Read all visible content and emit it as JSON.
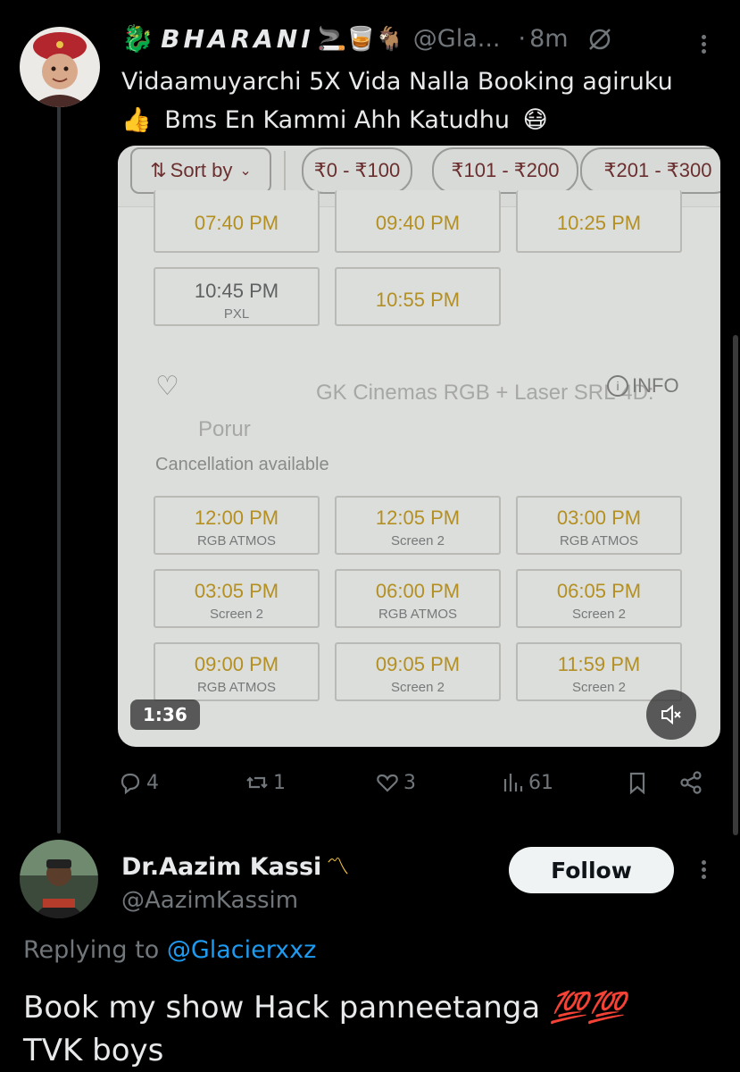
{
  "tweet1": {
    "name": "BHARANI",
    "name_emoji": [
      "🐉"
    ],
    "name_trailing_emoji": [
      "🚬",
      "🥃",
      "🐐"
    ],
    "handle": "@Gla...",
    "separator": "·",
    "time": "8m",
    "text_line1": "Vidaamuyarchi 5X Vida Nalla Booking agiruku",
    "text_line2_emoji": "👍",
    "text_line2": "Bms En Kammi Ahh Katudhu",
    "text_line2_end_emoji": "😷",
    "media": {
      "sort_label": "Sort by",
      "price_chips": [
        "₹0 - ₹100",
        "₹101 - ₹200",
        "₹201 - ₹300"
      ],
      "top_times": [
        "07:40 PM",
        "09:40 PM",
        "10:25 PM"
      ],
      "row2": [
        {
          "time": "10:45 PM",
          "format": "PXL"
        },
        {
          "time": "10:55 PM",
          "format": ""
        }
      ],
      "theatre_line1": "GK Cinemas RGB + Laser SRL 4D:",
      "theatre_line2": "Porur",
      "info_label": "INFO",
      "cancellation": "Cancellation available",
      "showtimes": [
        {
          "time": "12:00 PM",
          "format": "RGB ATMOS"
        },
        {
          "time": "12:05 PM",
          "format": "Screen 2"
        },
        {
          "time": "03:00 PM",
          "format": "RGB ATMOS"
        },
        {
          "time": "03:05 PM",
          "format": "Screen 2"
        },
        {
          "time": "06:00 PM",
          "format": "RGB ATMOS"
        },
        {
          "time": "06:05 PM",
          "format": "Screen 2"
        },
        {
          "time": "09:00 PM",
          "format": "RGB ATMOS"
        },
        {
          "time": "09:05 PM",
          "format": "Screen 2"
        },
        {
          "time": "11:59 PM",
          "format": "Screen 2"
        }
      ],
      "duration": "1:36"
    },
    "actions": {
      "replies": "4",
      "reposts": "1",
      "likes": "3",
      "views": "61"
    }
  },
  "tweet2": {
    "name": "Dr.Aazim Kassi",
    "name_emoji": "〽",
    "handle": "@AazimKassim",
    "follow_label": "Follow",
    "replying_prefix": "Replying to",
    "replying_handle": "@Glacierxxz",
    "text_line1": "Book my show Hack panneetanga",
    "text_line1_emoji": "💯💯",
    "text_line2": "TVK boys"
  },
  "colors": {
    "background": "#000000",
    "text": "#e7e9ea",
    "muted": "#71767b",
    "link": "#1d9bf0",
    "showtime_gold": "#b48f22"
  }
}
